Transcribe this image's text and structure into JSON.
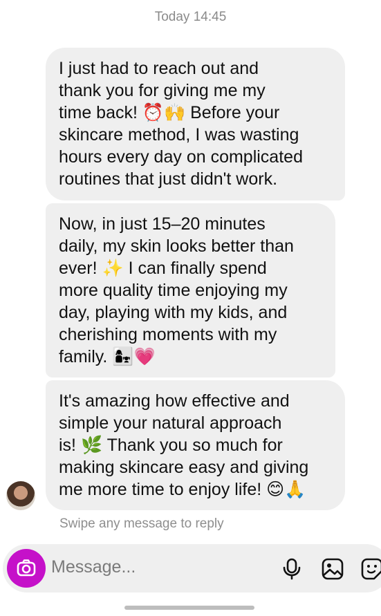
{
  "timestamp": "Today 14:45",
  "messages": [
    {
      "text": "I just had to reach out and\nthank you for giving me my\ntime back! ⏰🙌 Before your\nskincare method, I was wasting\nhours every day on complicated\nroutines that just didn't work."
    },
    {
      "text": "Now, in just 15–20 minutes\ndaily, my skin looks better than\never! ✨ I can finally spend\nmore quality time enjoying my\nday, playing with my kids, and\ncherishing moments with my\nfamily. 👩‍👧💗"
    },
    {
      "text": "It's amazing how effective and\nsimple your natural approach\nis! 🌿 Thank you so much for\nmaking skincare easy and giving\nme more time to enjoy life! 😊🙏"
    }
  ],
  "swipe_hint": "Swipe any message to reply",
  "composer": {
    "placeholder": "Message...",
    "icons": [
      "camera-icon",
      "microphone-icon",
      "gallery-icon",
      "sticker-icon"
    ],
    "camera_color": "#c511c9"
  }
}
